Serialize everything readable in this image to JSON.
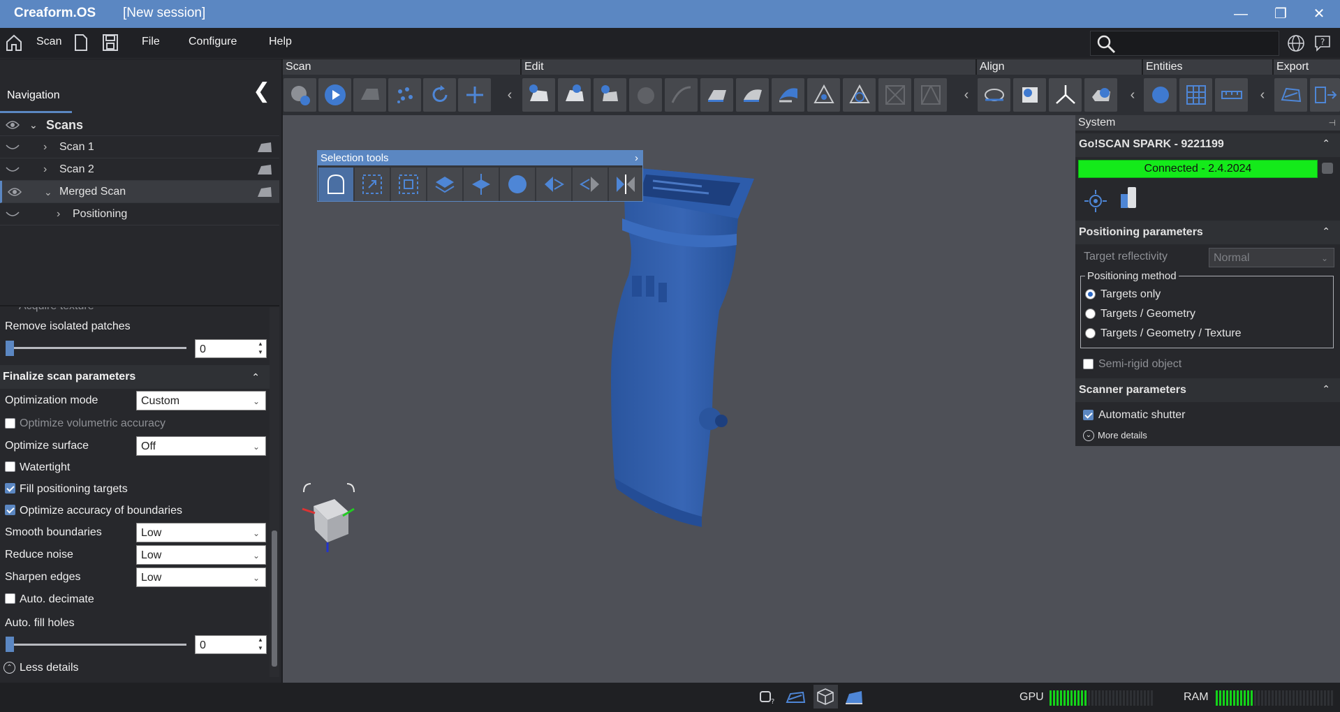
{
  "window": {
    "app_name": "Creaform.OS",
    "session": "[New session]"
  },
  "menubar": {
    "scan_label": "Scan",
    "file": "File",
    "configure": "Configure",
    "help": "Help"
  },
  "toolbar_groups": {
    "scan": "Scan",
    "edit": "Edit",
    "align": "Align",
    "entities": "Entities",
    "export": "Export"
  },
  "navigation": {
    "tab": "Navigation",
    "tree": [
      {
        "label": "Scans",
        "visible": true,
        "expanded": true
      },
      {
        "label": "Scan 1",
        "visible": false,
        "expanded": false
      },
      {
        "label": "Scan 2",
        "visible": false,
        "expanded": false
      },
      {
        "label": "Merged Scan",
        "visible": true,
        "expanded": true,
        "selected": true
      },
      {
        "label": "Positioning",
        "visible": false,
        "expanded": false
      }
    ]
  },
  "scan_params": {
    "acquire_texture": "Acquire texture",
    "remove_isolated_patches": "Remove isolated patches",
    "remove_isolated_value": "0",
    "finalize_header": "Finalize scan parameters",
    "optimization_mode_label": "Optimization mode",
    "optimization_mode_value": "Custom",
    "optimize_volumetric": "Optimize volumetric accuracy",
    "optimize_surface_label": "Optimize surface",
    "optimize_surface_value": "Off",
    "watertight": "Watertight",
    "fill_positioning_targets": "Fill positioning targets",
    "optimize_boundaries": "Optimize accuracy of boundaries",
    "smooth_boundaries_label": "Smooth boundaries",
    "smooth_boundaries_value": "Low",
    "reduce_noise_label": "Reduce noise",
    "reduce_noise_value": "Low",
    "sharpen_edges_label": "Sharpen edges",
    "sharpen_edges_value": "Low",
    "auto_decimate": "Auto. decimate",
    "auto_fill_holes": "Auto. fill holes",
    "auto_fill_value": "0",
    "less_details": "Less details"
  },
  "selection_tools": {
    "title": "Selection tools"
  },
  "system": {
    "header": "System",
    "device": "Go!SCAN SPARK - 9221199",
    "status": "Connected - 2.4.2024",
    "status_color": "#14ea1a",
    "positioning_header": "Positioning parameters",
    "target_reflectivity_label": "Target reflectivity",
    "target_reflectivity_value": "Normal",
    "positioning_method_label": "Positioning method",
    "methods": [
      "Targets only",
      "Targets / Geometry",
      "Targets / Geometry / Texture"
    ],
    "selected_method": "Targets only",
    "semi_rigid": "Semi-rigid object",
    "scanner_header": "Scanner parameters",
    "automatic_shutter": "Automatic shutter",
    "more_details": "More details"
  },
  "status": {
    "gpu": "GPU",
    "ram": "RAM",
    "gpu_level": 0.38,
    "ram_level": 0.32
  },
  "colors": {
    "accent": "#5b87c2",
    "model": "#2b5aa6"
  }
}
